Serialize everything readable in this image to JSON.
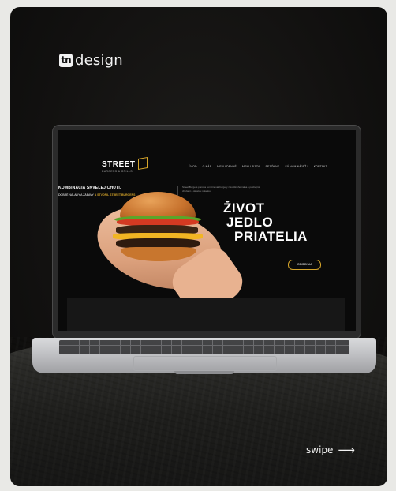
{
  "brand": {
    "mark": "tn",
    "name": "design"
  },
  "site": {
    "logo": "STREET",
    "logo_sub": "BURGERS & GRILLS",
    "nav": [
      "ÚVOD",
      "O NÁS",
      "MENU DENNÉ",
      "MENU PIZZA",
      "SEZÓNNE",
      "SÚ VÁM NÁJSŤ !",
      "KONTAKT"
    ],
    "headline": [
      "ŽIVOT",
      "JEDLO",
      "PRIATELIA"
    ],
    "cta": "OBJEDNAJ",
    "band_title": "KOMBINÁCIA SKVELEJ CHUTI,",
    "band_sub_prefix": "DOBRÉ NÁLADY A ZÁBAVY",
    "band_sub_accent": "A STVORIL STREET BURGERS",
    "band_text": "Street Burgers ponúka kombinovať burgery z kvalitného mäsa s poctivými chuťami a skvelou náladou."
  },
  "footer": {
    "swipe_label": "swipe",
    "swipe_icon": "arrow-right-icon"
  },
  "colors": {
    "accent": "#d6a52a",
    "card_bg": "#121110",
    "page_bg": "#e9e9e6"
  }
}
